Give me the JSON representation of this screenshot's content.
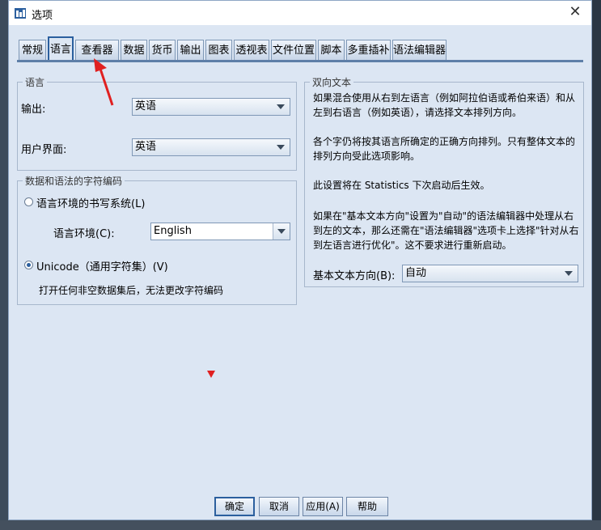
{
  "window": {
    "title": "选项",
    "close_label": "✕"
  },
  "tabs": [
    {
      "label": "常规"
    },
    {
      "label": "语言"
    },
    {
      "label": "查看器"
    },
    {
      "label": "数据"
    },
    {
      "label": "货币"
    },
    {
      "label": "输出"
    },
    {
      "label": "图表"
    },
    {
      "label": "透视表"
    },
    {
      "label": "文件位置"
    },
    {
      "label": "脚本"
    },
    {
      "label": "多重插补"
    },
    {
      "label": "语法编辑器"
    }
  ],
  "active_tab": "语言",
  "language": {
    "legend": "语言",
    "output_label": "输出:",
    "output_value": "英语",
    "ui_label": "用户界面:",
    "ui_value": "英语"
  },
  "encoding": {
    "legend": "数据和语法的字符编码",
    "locale_radio": "语言环境的书写系统(L)",
    "locale_label": "语言环境(C):",
    "locale_value": "English",
    "unicode_radio": "Unicode（通用字符集）(V)",
    "note": "打开任何非空数据集后，无法更改字符编码",
    "selected": "unicode"
  },
  "bidi": {
    "legend": "双向文本",
    "para1": "如果混合使用从右到左语言（例如阿拉伯语或希伯来语）和从左到右语言（例如英语），请选择文本排列方向。",
    "para2": "各个字仍将按其语言所确定的正确方向排列。只有整体文本的排列方向受此选项影响。",
    "para3": "此设置将在 Statistics 下次启动后生效。",
    "para4": "如果在\"基本文本方向\"设置为\"自动\"的语法编辑器中处理从右到左的文本，那么还需在\"语法编辑器\"选项卡上选择\"针对从右到左语言进行优化\"。这不要求进行重新启动。",
    "direction_label": "基本文本方向(B):",
    "direction_value": "自动"
  },
  "footer": {
    "ok": "确定",
    "cancel": "取消",
    "apply": "应用(A)",
    "help": "帮助"
  },
  "colors": {
    "accent": "#2b5f9e",
    "dialog_bg": "#dce6f3",
    "marker": "#e02020"
  }
}
